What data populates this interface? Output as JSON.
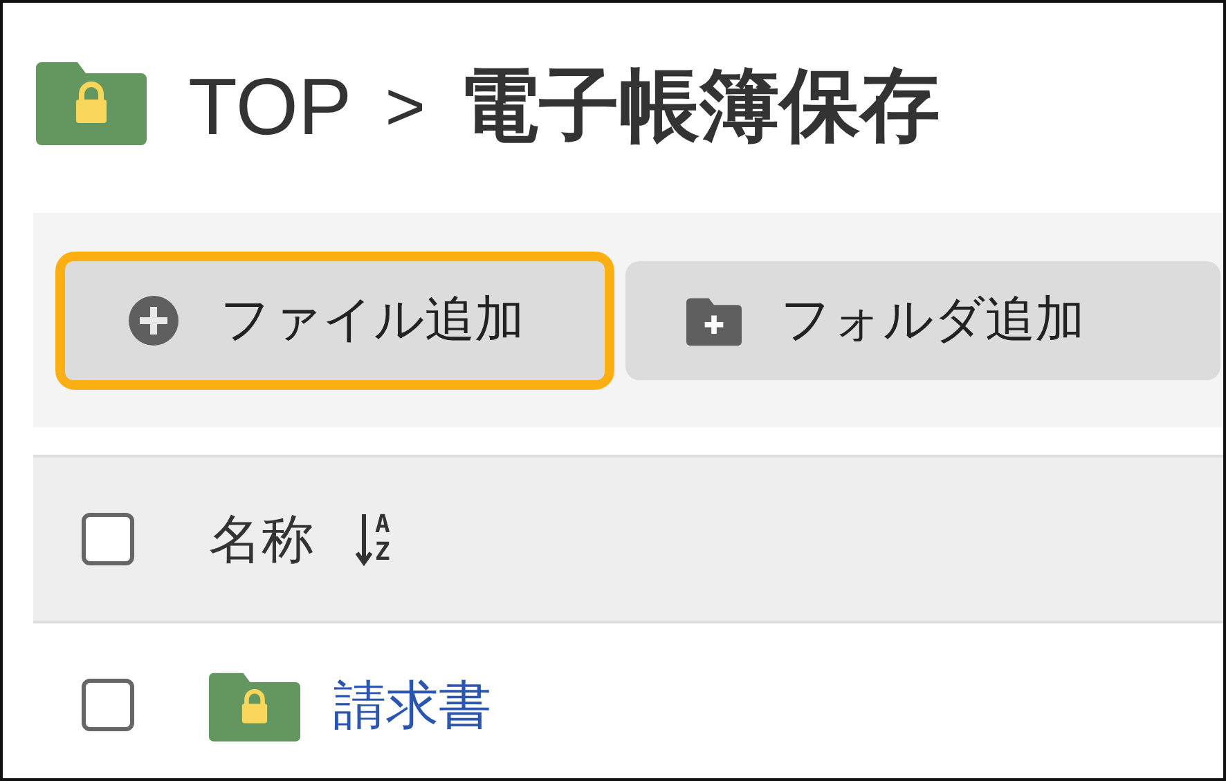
{
  "breadcrumb": {
    "root": "TOP",
    "separator": ">",
    "current": "電子帳簿保存"
  },
  "toolbar": {
    "buttons": [
      {
        "kind": "file",
        "label": "ファイル追加",
        "highlighted": true
      },
      {
        "kind": "folder",
        "label": "フォルダ追加",
        "highlighted": false
      }
    ]
  },
  "table": {
    "header": {
      "checked": false,
      "label": "名称",
      "sort_letters": [
        "A",
        "Z"
      ]
    },
    "rows": [
      {
        "kind": "folder",
        "name": "請求書",
        "checked": false
      }
    ]
  }
}
